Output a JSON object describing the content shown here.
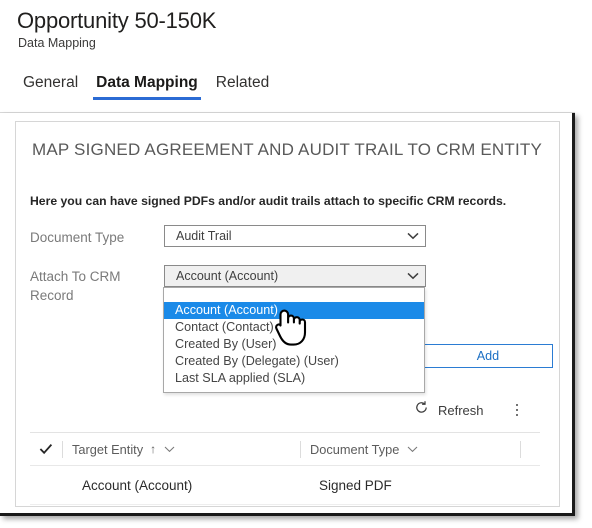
{
  "header": {
    "title": "Opportunity 50-150K",
    "subtitle": "Data Mapping",
    "tabs": [
      {
        "label": "General",
        "active": false
      },
      {
        "label": "Data Mapping",
        "active": true
      },
      {
        "label": "Related",
        "active": false
      }
    ],
    "active_tab_underline_color": "#2b6bd4"
  },
  "section": {
    "heading": "MAP SIGNED AGREEMENT AND AUDIT TRAIL TO CRM ENTITY",
    "description": "Here you can have signed PDFs and/or audit trails attach to specific CRM records."
  },
  "form": {
    "document_type": {
      "label": "Document Type",
      "value": "Audit Trail",
      "chevron_icon": "chevron-down-icon"
    },
    "attach_to_crm_record": {
      "label": "Attach To CRM Record",
      "value": "Account (Account)",
      "chevron_icon": "chevron-down-icon",
      "expanded": true,
      "options": [
        "Account (Account)",
        "Contact (Contact)",
        "Created By (User)",
        "Created By (Delegate) (User)",
        "Last SLA applied (SLA)"
      ],
      "selected_option": "Account (Account)",
      "highlight_color": "#1b8ae8"
    }
  },
  "actions": {
    "add_label": "Add",
    "add_accent_color": "#2b7cd3",
    "refresh_label": "Refresh",
    "refresh_icon": "refresh-icon",
    "overflow_icon": "more-vertical-icon"
  },
  "grid": {
    "select_all_icon": "checkmark-icon",
    "columns": [
      {
        "label": "Target Entity",
        "sorted": true,
        "sort_icon": "arrow-up-icon",
        "chevron_icon": "chevron-down-icon"
      },
      {
        "label": "Document Type",
        "sorted": false,
        "chevron_icon": "chevron-down-icon"
      }
    ],
    "rows": [
      {
        "target_entity": "Account (Account)",
        "document_type": "Signed PDF"
      }
    ]
  },
  "cursor": {
    "icon": "hand-pointer-cursor"
  }
}
